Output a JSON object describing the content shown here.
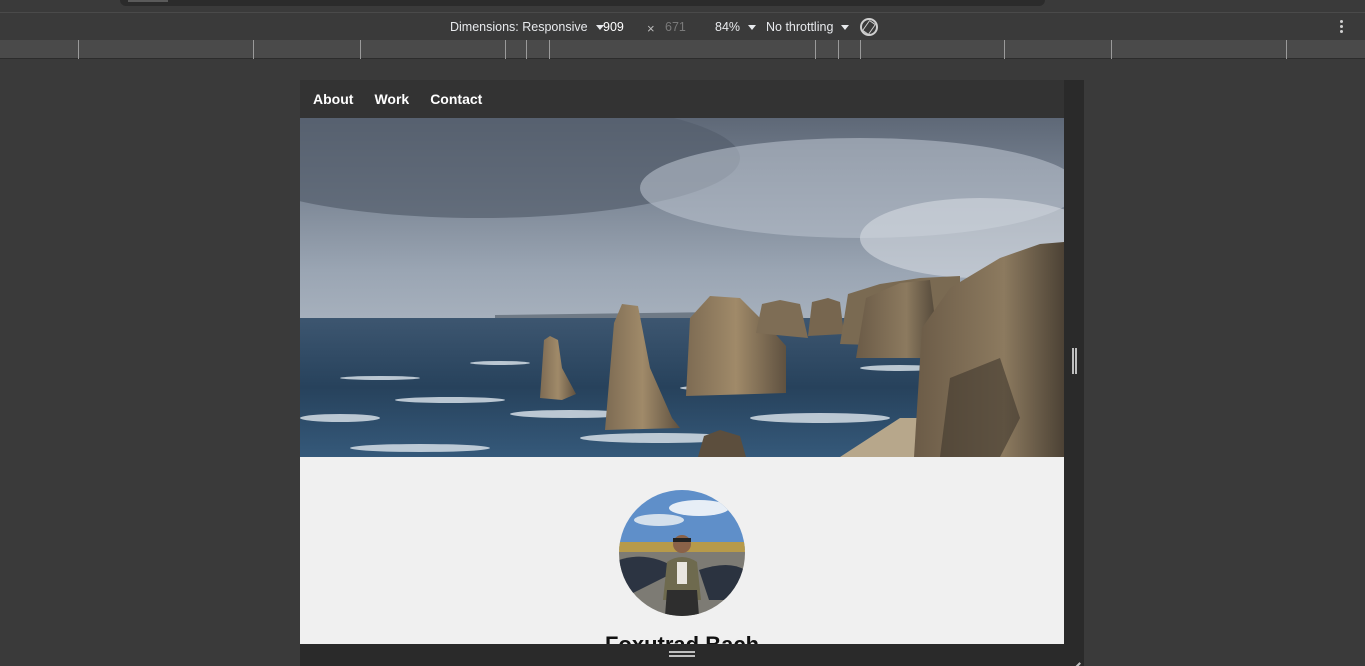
{
  "devtools": {
    "dimensions_label": "Dimensions: Responsive",
    "width_value": "909",
    "times_sign": "×",
    "height_value": "671",
    "zoom": "84%",
    "throttling": "No throttling",
    "icons": [
      "caret-down-icon",
      "rotate-icon",
      "kebab-menu-icon"
    ]
  },
  "page": {
    "nav": {
      "items": [
        {
          "label": "About"
        },
        {
          "label": "Work"
        },
        {
          "label": "Contact"
        }
      ]
    },
    "hero_alt": "",
    "name": "Foxutrad Bach"
  }
}
